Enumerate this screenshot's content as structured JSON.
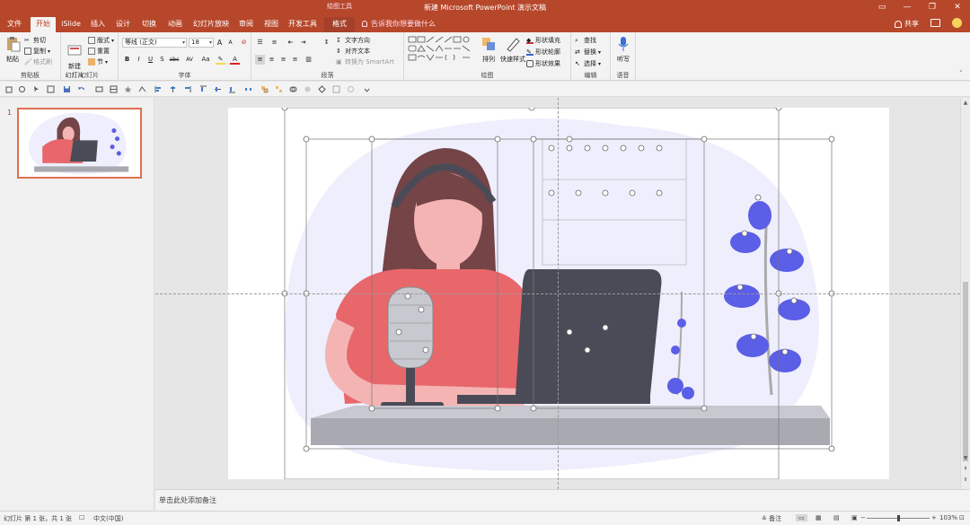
{
  "window": {
    "title": "新建 Microsoft PowerPoint 演示文稿",
    "context_group_label": "绘图工具",
    "controls": [
      "—",
      "▭",
      "❐",
      "✕"
    ]
  },
  "ribbon_tabs": [
    {
      "label": "文件"
    },
    {
      "label": "开始"
    },
    {
      "label": "iSlide"
    },
    {
      "label": "插入"
    },
    {
      "label": "设计"
    },
    {
      "label": "切换"
    },
    {
      "label": "动画"
    },
    {
      "label": "幻灯片放映"
    },
    {
      "label": "审阅"
    },
    {
      "label": "视图"
    },
    {
      "label": "开发工具"
    },
    {
      "label": "格式"
    }
  ],
  "tell_me": "告诉我你想要做什么",
  "share": "共享",
  "clipboard": {
    "paste": "粘贴",
    "cut": "剪切",
    "copy": "复制",
    "format_painter": "格式刷",
    "group": "剪贴板"
  },
  "slides_group": {
    "new_slide": "新建\n幻灯片",
    "layout": "版式",
    "reset": "重置",
    "section": "节",
    "group": "幻灯片"
  },
  "font_group": {
    "font_name": "等线 (正文)",
    "font_size": "18",
    "group": "字体",
    "bold": "B",
    "italic": "I",
    "underline": "U",
    "shadow": "S",
    "strike": "abc",
    "spacing": "AV",
    "case": "Aa",
    "grow": "A",
    "shrink": "A"
  },
  "paragraph_group": {
    "text_direction": "文字方向",
    "align_text": "对齐文本",
    "smartart": "转换为 SmartArt",
    "group": "段落"
  },
  "drawing_group": {
    "arrange": "排列",
    "quick_styles": "快速样式",
    "fill": "形状填充",
    "outline": "形状轮廓",
    "effects": "形状效果",
    "group": "绘图"
  },
  "editing_group": {
    "find": "查找",
    "replace": "替换",
    "select": "选择",
    "group": "编辑"
  },
  "voice_group": {
    "dictate": "听写",
    "group": "语音"
  },
  "slide_list": {
    "number": "1"
  },
  "notes_placeholder": "单击此处添加备注",
  "status": {
    "slide_info": "幻灯片 第 1 张，共 1 张",
    "language": "中文(中国)",
    "notes": "备注",
    "zoom": "103%",
    "zoom_level": 0.5
  },
  "colors": {
    "brand": "#b7472a",
    "accent_blue": "#5b5ee6",
    "laptop": "#4b4b57",
    "shirt": "#e8676b",
    "hair": "#744447",
    "skin": "#f4b4b4",
    "desk": "#a9a9b2",
    "blob": "#eeeefc"
  }
}
